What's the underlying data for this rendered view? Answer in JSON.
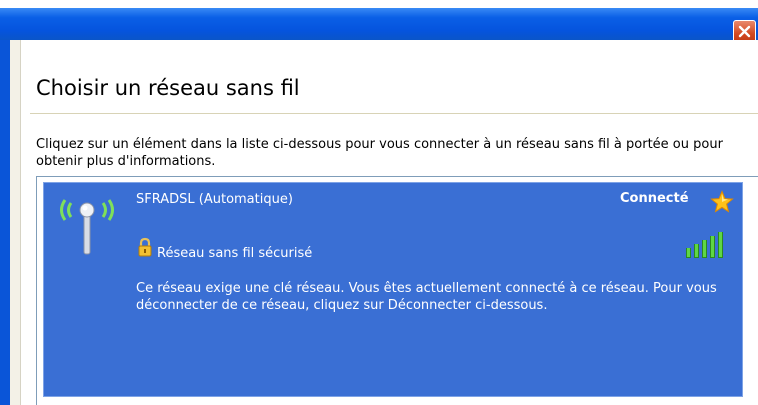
{
  "window": {
    "close_icon": "close-icon",
    "colors": {
      "titlebar": "#0554de",
      "close": "#d34a22",
      "selection": "#3a6fd4"
    }
  },
  "header": {
    "title": "Choisir un réseau sans fil"
  },
  "instructions": "Cliquez sur un élément dans la liste ci-dessous pour vous connecter à un réseau sans fil à portée ou pour obtenir plus d'informations.",
  "network": {
    "name": "SFRADSL (Automatique)",
    "status": "Connecté",
    "security": "Réseau sans fil sécurisé",
    "description": "Ce réseau exige une clé réseau. Vous êtes actuellement connecté à ce réseau. Pour vous déconnecter de ce réseau, cliquez sur Déconnecter ci-dessous.",
    "icons": [
      "wireless-antenna-icon",
      "star-icon",
      "lock-icon",
      "signal-strength-icon"
    ],
    "signal_bars": 5
  }
}
